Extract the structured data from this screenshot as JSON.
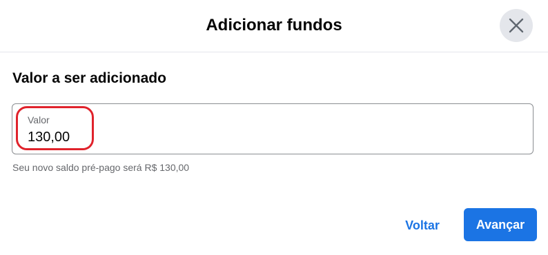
{
  "dialog": {
    "title": "Adicionar fundos",
    "close_icon": "close-icon"
  },
  "amount_section": {
    "title": "Valor a ser adicionado",
    "field": {
      "label": "Valor",
      "value": "130,00"
    },
    "helper_text": "Seu novo saldo pré-pago será R$ 130,00"
  },
  "footer": {
    "back_label": "Voltar",
    "next_label": "Avançar"
  },
  "colors": {
    "accent": "#1b74e4",
    "highlight": "#e0222b",
    "close_button_bg": "#e4e6eb"
  }
}
